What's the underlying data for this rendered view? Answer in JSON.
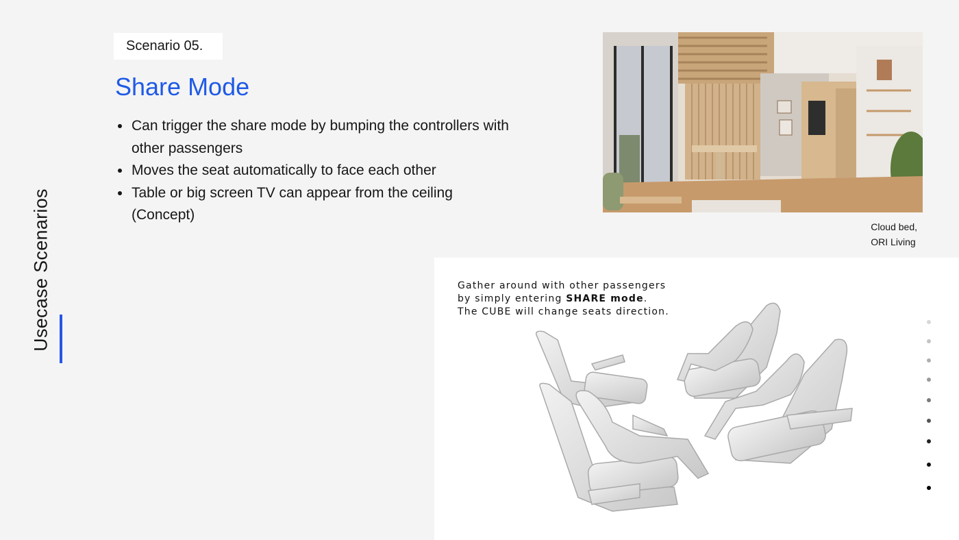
{
  "sidebar": {
    "label": "Usecase Scenarios"
  },
  "badge": {
    "text": "Scenario 05."
  },
  "title": "Share Mode",
  "bullets": [
    "Can trigger the share mode by bumping the controllers with other passengers",
    "Moves the seat automatically to face each other",
    "Table or big screen TV can appear from the ceiling (Concept)"
  ],
  "photo": {
    "caption_line1": "Cloud bed,",
    "caption_line2": "ORI Living"
  },
  "panel": {
    "line1": "Gather around with other passengers",
    "line2_prefix": "by simply entering ",
    "line2_bold": "SHARE mode",
    "line2_suffix": ".",
    "line3": "The CUBE will change seats direction."
  },
  "pagination": {
    "dot_colors": [
      "#d8d8d8",
      "#c4c4c4",
      "#b0b0b0",
      "#9a9a9a",
      "#7a7a7a",
      "#555555",
      "#222222",
      "#111111",
      "#000000"
    ]
  },
  "colors": {
    "accent": "#1f5ae6",
    "background": "#f4f4f4",
    "panel": "#ffffff"
  }
}
